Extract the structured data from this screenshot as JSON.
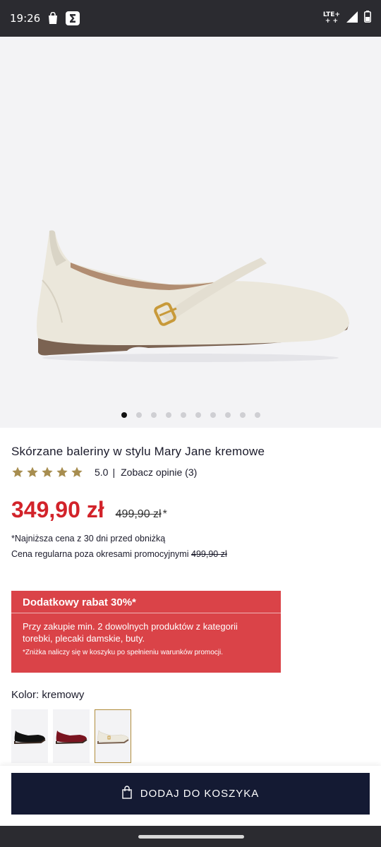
{
  "status_bar": {
    "time": "19:26",
    "network": "LTE+",
    "network_sub": "+ +"
  },
  "gallery": {
    "total_images": 10,
    "active_index": 0
  },
  "product": {
    "title": "Skórzane baleriny w stylu Mary Jane kremowe",
    "rating": "5.0",
    "rating_sep": "|",
    "stars": 5,
    "reviews_link": "Zobacz opinie (3)",
    "price": "349,90 zł",
    "old_price": "499,90 zł",
    "asterisk": "*",
    "lowest_price_note": "*Najniższa cena z 30 dni przed obniżką",
    "regular_price_label": "Cena regularna poza okresami promocyjnymi",
    "regular_price": "499,90 zł"
  },
  "promo": {
    "title": "Dodatkowy rabat 30%*",
    "description": "Przy zakupie min. 2 dowolnych produktów z kategorii torebki, plecaki damskie, buty.",
    "footnote": "*Zniżka naliczy się w koszyku po spełnieniu warunków promocji."
  },
  "color": {
    "label": "Kolor: kremowy",
    "variants": [
      {
        "name": "czarny",
        "hex": "#111111"
      },
      {
        "name": "bordowy",
        "hex": "#7a1420"
      },
      {
        "name": "kremowy",
        "hex": "#ece8dc",
        "selected": true
      }
    ]
  },
  "cart": {
    "button_label": "DODAJ DO KOSZYKA"
  },
  "colors": {
    "price_red": "#d2232a",
    "promo_red": "#da4348",
    "button_navy": "#141a33",
    "star_gold": "#a78d4f"
  }
}
